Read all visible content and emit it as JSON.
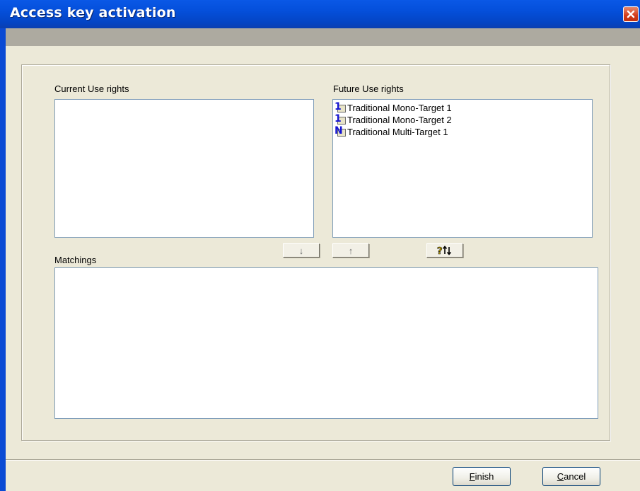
{
  "window": {
    "title": "Access key activation"
  },
  "current": {
    "label": "Current Use rights",
    "items": []
  },
  "future": {
    "label": "Future Use rights",
    "items": [
      {
        "icon_glyph": "1",
        "icon": "mono-target-icon",
        "label": "Traditional Mono-Target 1"
      },
      {
        "icon_glyph": "1",
        "icon": "mono-target-icon",
        "label": "Traditional Mono-Target 2"
      },
      {
        "icon_glyph": "N",
        "icon": "multi-target-icon",
        "label": "Traditional Multi-Target 1"
      }
    ]
  },
  "matchings": {
    "label": "Matchings",
    "items": []
  },
  "buttons": {
    "move_down_glyph": "↓",
    "move_up_glyph": "↑",
    "auto_match_icon": "auto-match-icon",
    "finish_mnemonic": "F",
    "finish_rest": "inish",
    "cancel_mnemonic": "C",
    "cancel_rest": "ancel"
  },
  "colors": {
    "titlebar": "#0550dc",
    "background": "#ece9d8",
    "close": "#d23b1a",
    "icon_glyph": "#1414d2"
  }
}
